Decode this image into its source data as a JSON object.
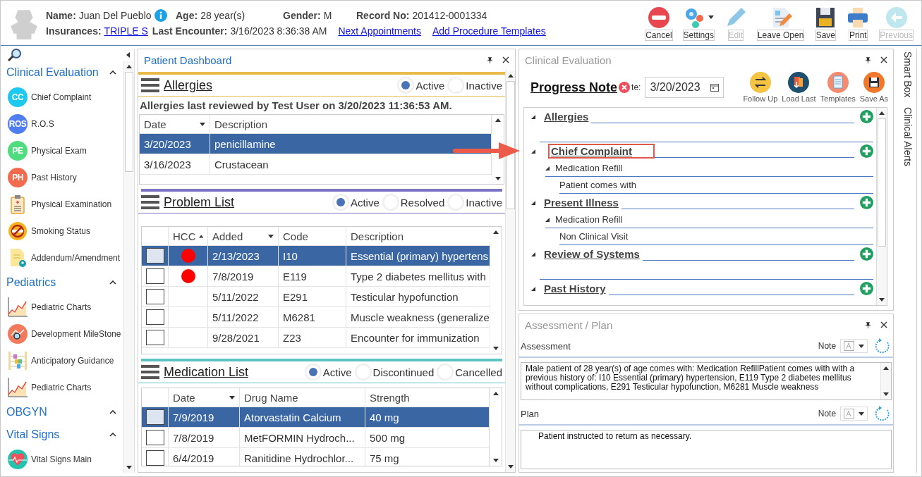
{
  "header": {
    "fields_top": [
      {
        "label": "Name:",
        "value": "Juan Del Pueblo",
        "info": true
      },
      {
        "label": "Age:",
        "value": "28 year(s)"
      },
      {
        "label": "Gender:",
        "value": "M"
      },
      {
        "label": "Record No:",
        "value": "201412-0001334"
      }
    ],
    "fields_bottom": [
      {
        "label": "Insurances:",
        "value": "TRIPLE S",
        "link": true
      },
      {
        "label": "Last Encounter:",
        "value": "3/16/2023 8:36:38 AM"
      }
    ],
    "links": [
      "Next Appointments",
      "Add Procedure Templates"
    ]
  },
  "toolbar": [
    {
      "kind": "cancel",
      "label": "Cancel",
      "disabled": false
    },
    {
      "kind": "settings",
      "label": "Settings",
      "disabled": false,
      "dropdown": true
    },
    {
      "kind": "edit",
      "label": "Edit",
      "disabled": true
    },
    {
      "kind": "leave-open",
      "label": "Leave Open",
      "disabled": false
    },
    {
      "kind": "save",
      "label": "Save",
      "disabled": false
    },
    {
      "kind": "print",
      "label": "Print",
      "disabled": false
    },
    {
      "kind": "previous",
      "label": "Previous",
      "disabled": true
    }
  ],
  "sidebar": {
    "groups": [
      {
        "title": "Clinical Evaluation",
        "items": [
          {
            "label": "Chief Complaint",
            "kind": "badge",
            "badge": "CC",
            "color": "#1ec8ee"
          },
          {
            "label": "R.O.S",
            "kind": "badge",
            "badge": "ROS",
            "color": "#4f7ef0"
          },
          {
            "label": "Physical Exam",
            "kind": "badge",
            "badge": "PE",
            "color": "#4fdc7e"
          },
          {
            "label": "Past History",
            "kind": "badge",
            "badge": "PH",
            "color": "#f26b4f"
          },
          {
            "label": "Physical Examination",
            "kind": "clipboard"
          },
          {
            "label": "Smoking Status",
            "kind": "no-smoking"
          },
          {
            "label": "Addendum/Amendment",
            "kind": "document"
          }
        ]
      },
      {
        "title": "Pediatrics",
        "items": [
          {
            "label": "Pediatric Charts",
            "kind": "line-chart"
          },
          {
            "label": "Development MileStone",
            "kind": "milestones"
          },
          {
            "label": "Anticipatory Guidance",
            "kind": "abacus"
          },
          {
            "label": "Pediatric Charts",
            "kind": "line-chart"
          }
        ]
      },
      {
        "title": "OBGYN"
      },
      {
        "title": "Vital Signs",
        "items": [
          {
            "label": "Vital Signs Main",
            "kind": "heart"
          }
        ]
      }
    ]
  },
  "dashboard": {
    "title": "Patient Dashboard",
    "sections": [
      {
        "title": "Allergies",
        "color": "#e9b949",
        "filters": [
          {
            "label": "Active",
            "selected": true
          },
          {
            "label": "Inactive",
            "selected": false
          }
        ],
        "note": "Allergies last reviewed by Test User on 3/20/2023 11:36:53 AM.",
        "table": {
          "selector": false,
          "hcc": false,
          "columns": [
            {
              "label": "Date",
              "filter": true,
              "sorted": false
            },
            {
              "label": "Description",
              "filter": false,
              "sorted": false
            }
          ],
          "rows": [
            {
              "selected": true,
              "cells": [
                "3/20/2023",
                "penicillamine"
              ]
            },
            {
              "selected": false,
              "cells": [
                "3/16/2023",
                "Crustacean"
              ]
            }
          ]
        }
      },
      {
        "title": "Problem List",
        "color": "#7b73c4",
        "filters": [
          {
            "label": "Active",
            "selected": true
          },
          {
            "label": "Resolved",
            "selected": false
          },
          {
            "label": "Inactive",
            "selected": false
          }
        ],
        "table": {
          "selector": true,
          "hcc": true,
          "columns": [
            {
              "label": "HCC",
              "filter": false,
              "sorted": true
            },
            {
              "label": "Added",
              "filter": true,
              "sorted": false
            },
            {
              "label": "Code",
              "filter": false,
              "sorted": false
            },
            {
              "label": "Description",
              "filter": false,
              "sorted": false
            }
          ],
          "rows": [
            {
              "selected": true,
              "hcc": true,
              "cells": [
                "",
                "2/13/2023",
                "I10",
                "Essential (primary) hypertens"
              ]
            },
            {
              "selected": false,
              "hcc": true,
              "cells": [
                "",
                "7/8/2019",
                "E119",
                "Type 2 diabetes mellitus with"
              ]
            },
            {
              "selected": false,
              "hcc": false,
              "cells": [
                "",
                "5/11/2022",
                "E291",
                "Testicular hypofunction"
              ]
            },
            {
              "selected": false,
              "hcc": false,
              "cells": [
                "",
                "5/11/2022",
                "M6281",
                "Muscle weakness (generalize"
              ]
            },
            {
              "selected": false,
              "hcc": false,
              "cells": [
                "",
                "9/28/2021",
                "Z23",
                "Encounter for immunization"
              ]
            }
          ]
        }
      },
      {
        "title": "Medication List",
        "color": "#5cc3c3",
        "filters": [
          {
            "label": "Active",
            "selected": true
          },
          {
            "label": "Discontinued",
            "selected": false
          },
          {
            "label": "Cancelled",
            "selected": false
          }
        ],
        "table": {
          "selector": true,
          "hcc": false,
          "columns": [
            {
              "label": "Date",
              "filter": true,
              "sorted": false
            },
            {
              "label": "Drug Name",
              "filter": false,
              "sorted": false
            },
            {
              "label": "Strength",
              "filter": false,
              "sorted": false
            }
          ],
          "rows": [
            {
              "selected": true,
              "cells": [
                "7/9/2019",
                "Atorvastatin Calcium",
                "40 mg"
              ]
            },
            {
              "selected": false,
              "cells": [
                "7/8/2019",
                "MetFORMIN Hydroch...",
                "500 mg"
              ]
            },
            {
              "selected": false,
              "cells": [
                "6/4/2019",
                "Ranitidine Hydrochlor...",
                "75 mg"
              ]
            }
          ]
        }
      }
    ]
  },
  "evaluation": {
    "title": "Clinical Evaluation",
    "note_title": "Progress Note",
    "date_label": "te:",
    "date": "3/20/2023",
    "actions": [
      {
        "kind": "follow-up",
        "label": "Follow Up"
      },
      {
        "kind": "load-last",
        "label": "Load Last"
      },
      {
        "kind": "templates",
        "label": "Templates"
      },
      {
        "kind": "save-as",
        "label": "Save As"
      }
    ],
    "sections": [
      {
        "title": "Allergies",
        "highlighted": false
      },
      {
        "title": "Chief Complaint",
        "highlighted": true,
        "children": [
          {
            "label": "Medication Refill",
            "children": [
              {
                "label": "Patient comes with"
              }
            ]
          }
        ]
      },
      {
        "title": "Present Illness",
        "highlighted": false,
        "children": [
          {
            "label": "Medication Refill",
            "children": [
              {
                "label": "Non Clinical Visit"
              }
            ]
          }
        ]
      },
      {
        "title": "Review of Systems",
        "highlighted": false
      },
      {
        "title": "Past History",
        "highlighted": false
      }
    ]
  },
  "assessment_plan": {
    "title": "Assessment / Plan",
    "parts": [
      {
        "label": "Assessment",
        "note_label": "Note",
        "text": "Male patient of 28 year(s) of age comes with: Medication RefillPatient comes with with a previous history of: I10 Essential (primary) hypertension, E119 Type 2 diabetes mellitus without complications, E291 Testicular hypofunction, M6281 Muscle weakness"
      },
      {
        "label": "Plan",
        "note_label": "Note",
        "text": "Patient instructed to return as necessary."
      }
    ]
  },
  "side_tabs": [
    "Smart Box",
    "Clinical Alerts"
  ]
}
